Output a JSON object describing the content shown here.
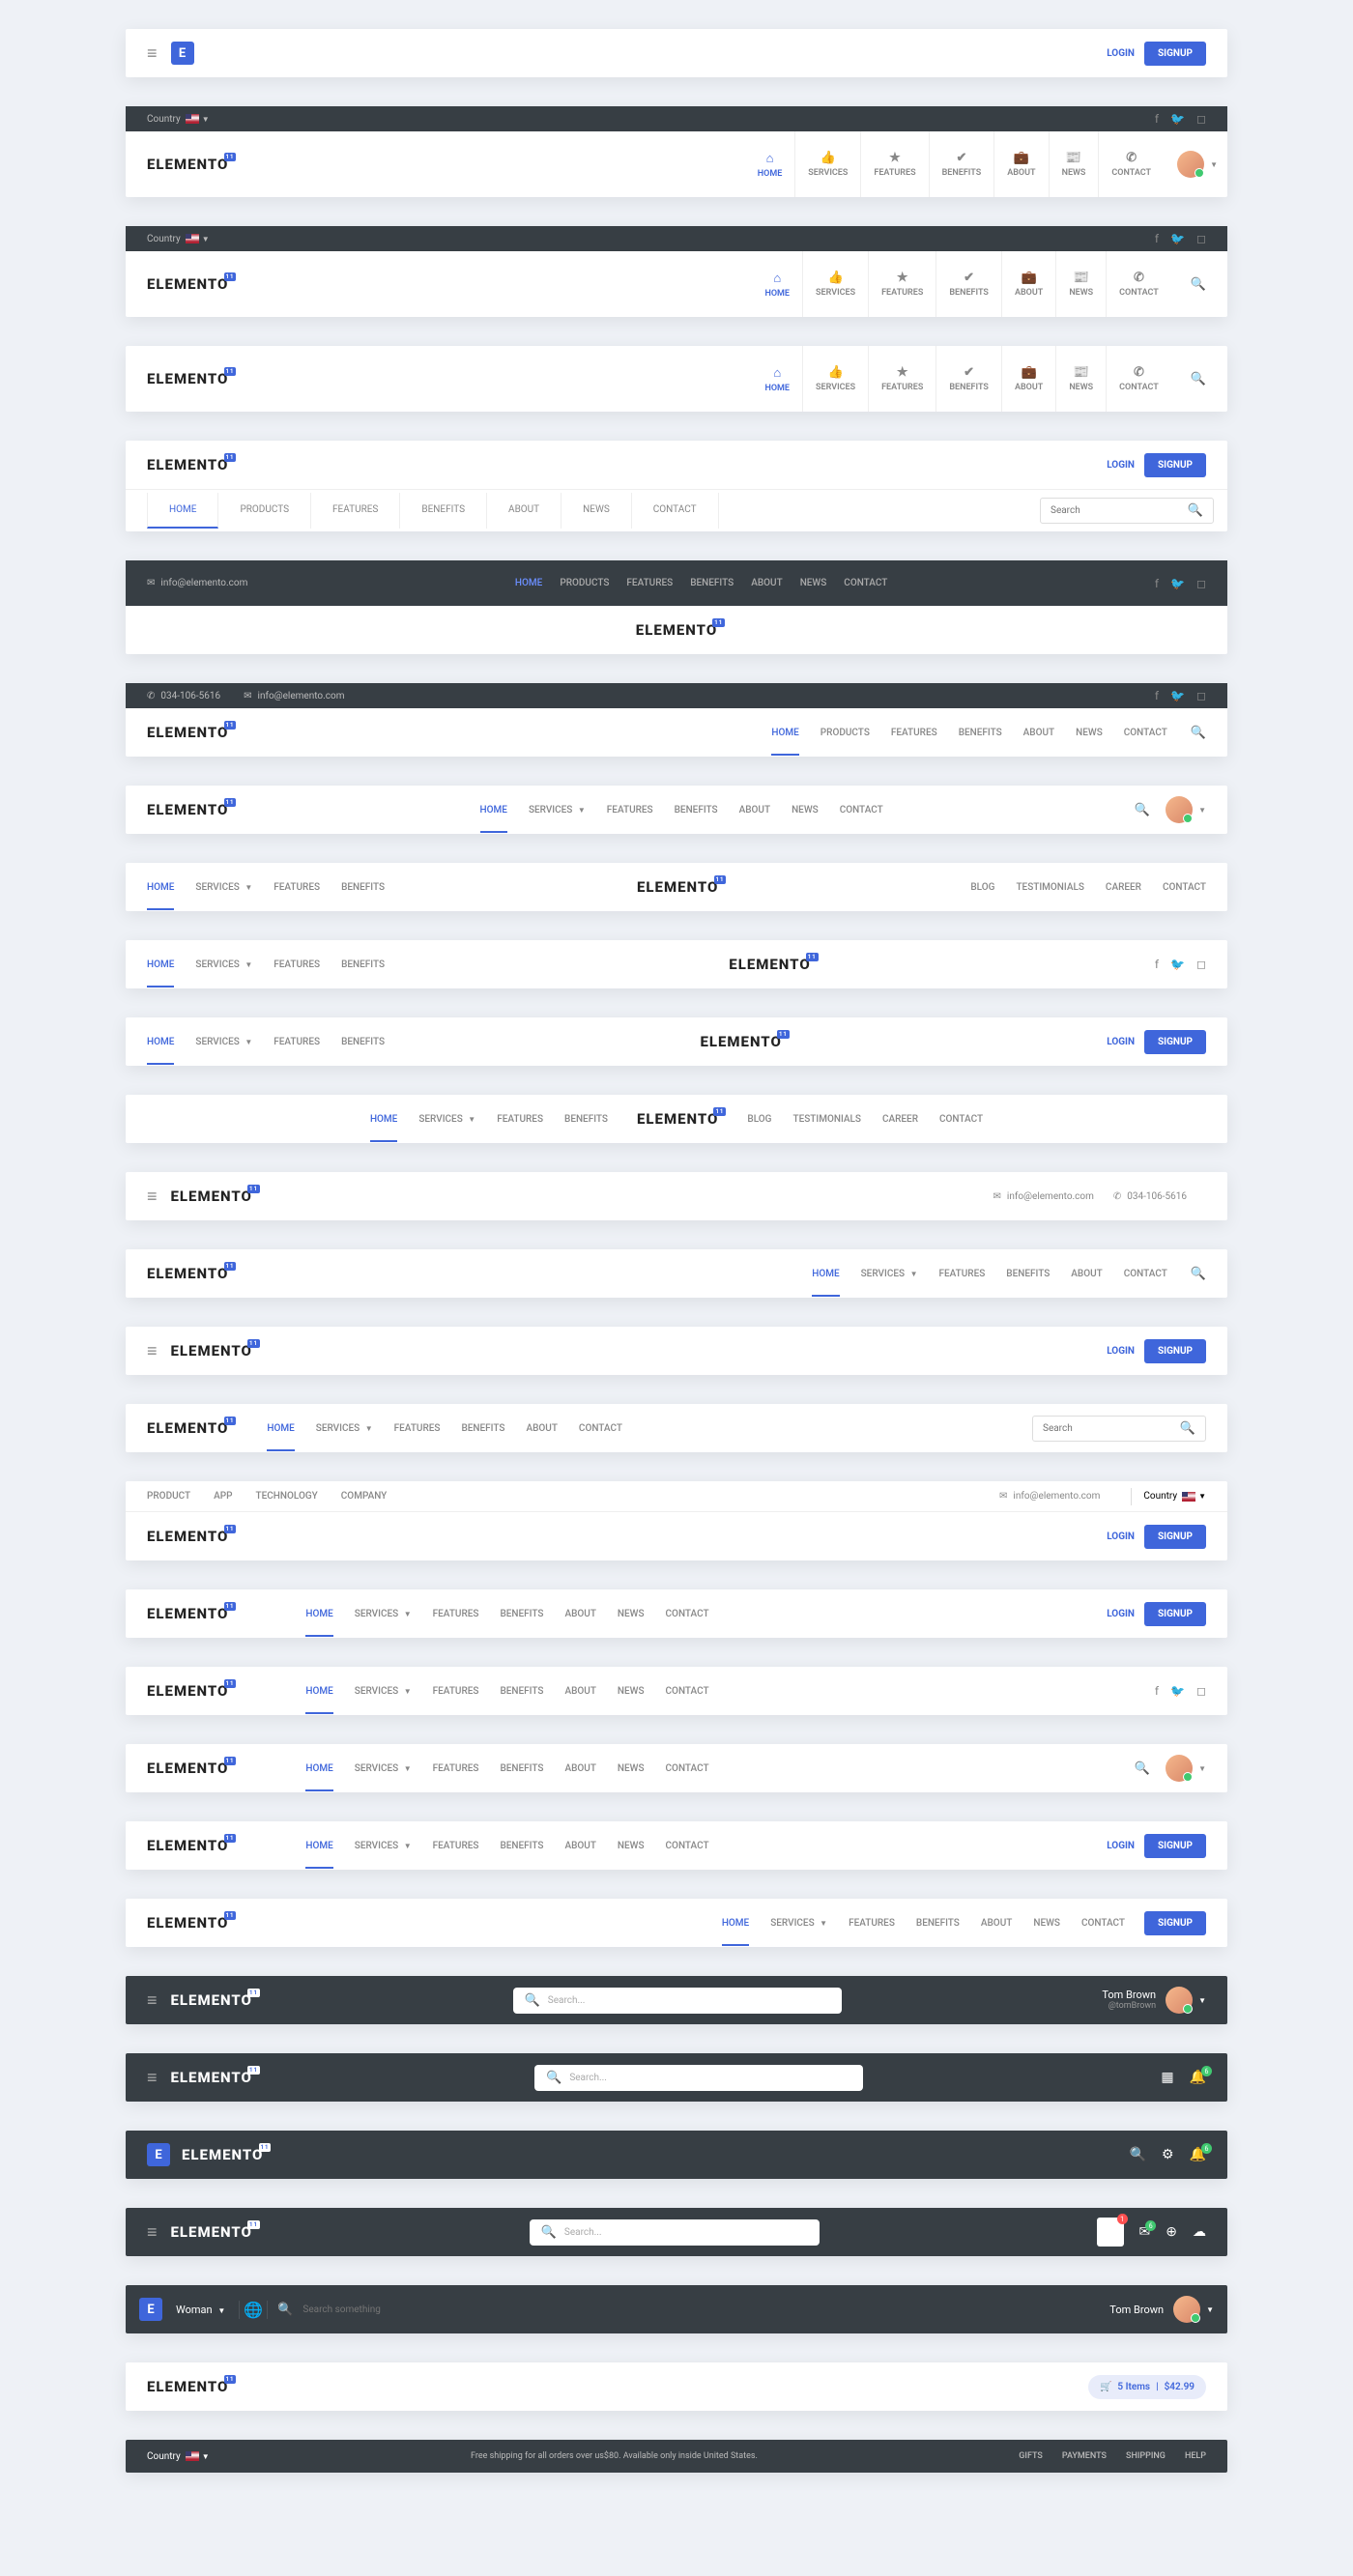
{
  "brand": "ELEMENTO",
  "login": "LOGIN",
  "signup": "SIGNUP",
  "country_label": "Country",
  "nav_icons": {
    "home": "HOME",
    "services": "SERVICES",
    "features": "FEATURES",
    "benefits": "BENEFITS",
    "about": "ABOUT",
    "news": "NEWS",
    "contact": "CONTACT"
  },
  "nav_h": {
    "home": "HOME",
    "products": "PRODUCTS",
    "features": "FEATURES",
    "benefits": "BENEFITS",
    "about": "ABOUT",
    "news": "NEWS",
    "contact": "CONTACT",
    "services": "SERVICES"
  },
  "rnav": {
    "blog": "BLOG",
    "testimonials": "TESTIMONIALS",
    "career": "CAREER",
    "contact": "CONTACT"
  },
  "secondary": {
    "product": "PRODUCT",
    "app": "APP",
    "technology": "TECHNOLOGY",
    "company": "COMPANY"
  },
  "email": "info@elemento.com",
  "phone": "034-106-5616",
  "search_ph": "Search",
  "search_ph2": "Search...",
  "search_ph3": "Search something",
  "user": {
    "name": "Tom Brown",
    "handle": "@tomBrown"
  },
  "cart": {
    "items": "5 Items",
    "total": "$42.99"
  },
  "promo": "Free shipping for all orders over us$80. Available only inside United States.",
  "footer": {
    "gifts": "GIFTS",
    "payments": "PAYMENTS",
    "shipping": "SHIPPING",
    "help": "HELP"
  },
  "woman": "Woman",
  "chart_data": null
}
